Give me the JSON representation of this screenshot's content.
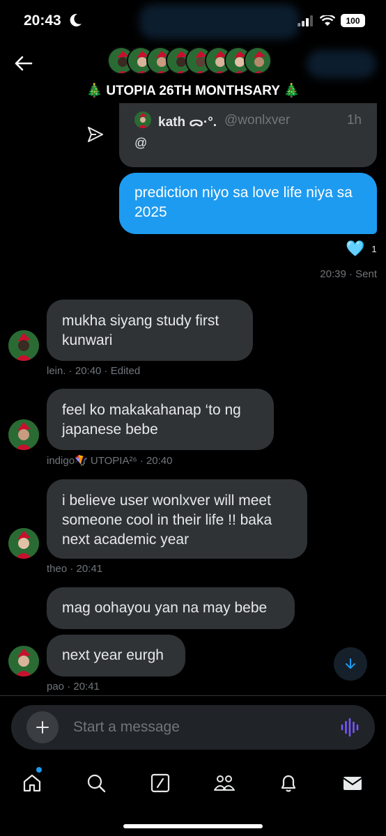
{
  "status_bar": {
    "time": "20:43",
    "battery": "100"
  },
  "header": {
    "title": "🎄 UTOPIA 26TH MONTHSARY 🎄",
    "member_avatars": 9
  },
  "quoted_post": {
    "name": "kath ᯅ·°.",
    "handle": "@wonlxver",
    "time": "1h",
    "text": "@"
  },
  "sent_message": {
    "text": "prediction niyo sa love life niya sa 2025",
    "reaction_emoji": "🩵",
    "reaction_count": "1",
    "meta": "20:39 · Sent"
  },
  "messages": [
    {
      "text": "mukha siyang study first kunwari",
      "meta": "lein. · 20:40 · Edited"
    },
    {
      "text": "feel ko makakahanap ‘to ng japanese bebe",
      "meta": "indigo🪁 UTOPIA²⁶ · 20:40"
    },
    {
      "text": "i believe user wonlxver will meet someone cool in their life !! baka next academic year",
      "meta": "theo · 20:41"
    },
    {
      "text": "mag oohayou yan na may bebe"
    },
    {
      "text": "next year eurgh",
      "meta": "pao · 20:41"
    }
  ],
  "composer": {
    "placeholder": "Start a message"
  },
  "tabs": [
    "home-icon",
    "search-icon",
    "grok-icon",
    "communities-icon",
    "notifications-icon",
    "messages-icon"
  ],
  "colors": {
    "accent": "#1d9bf0",
    "bubble": "#2f3336",
    "muted": "#71767b",
    "voice": "#7856ff"
  }
}
